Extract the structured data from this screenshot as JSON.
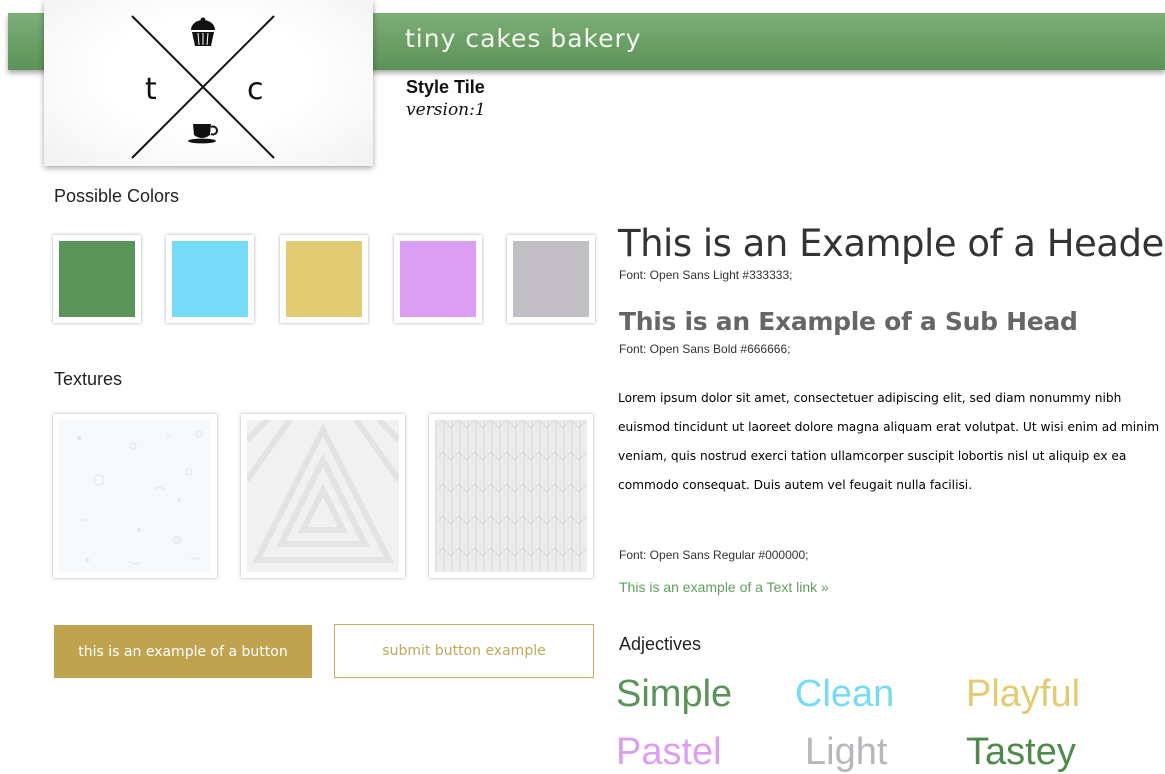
{
  "brand": {
    "name": "tiny cakes bakery"
  },
  "logo": {
    "left_letter": "t",
    "right_letter": "c"
  },
  "tile": {
    "title": "Style Tile",
    "version": "version:1"
  },
  "colors": {
    "label": "Possible Colors",
    "swatches": [
      "#5b9458",
      "#76dbf6",
      "#e1cb73",
      "#dc9ef2",
      "#c2bec5"
    ]
  },
  "textures": {
    "label": "Textures"
  },
  "buttons": {
    "primary_label": "this is an example of a button",
    "submit_label": "submit button example",
    "primary_color": "#bfa34f"
  },
  "typography": {
    "header": "This is an Example of a Header",
    "header_note": "Font: Open Sans Light #333333;",
    "subhead": "This is an Example of a Sub Head",
    "subhead_note": "Font: Open Sans Bold #666666;",
    "body": "Lorem ipsum dolor sit amet, consectetuer adipiscing elit, sed diam nonummy nibh euismod tincidunt ut laoreet dolore magna aliquam erat volutpat. Ut wisi enim ad minim veniam, quis nostrud exerci tation ullamcorper suscipit lobortis nisl ut aliquip ex ea commodo consequat. Duis autem vel feugait nulla facilisi.",
    "body_note": "Font: Open Sans Regular #000000;",
    "link": "This is an example of a Text link »",
    "link_color": "#5f9e5c"
  },
  "adjectives": {
    "label": "Adjectives",
    "items": [
      {
        "word": "Simple",
        "color": "#5b9458"
      },
      {
        "word": "Clean",
        "color": "#76dbf6"
      },
      {
        "word": "Playful",
        "color": "#e1cb73"
      },
      {
        "word": "Pastel",
        "color": "#dc9ef2"
      },
      {
        "word": "Light",
        "color": "#b9b6bb"
      },
      {
        "word": "Tastey",
        "color": "#4f8a4c"
      }
    ]
  }
}
